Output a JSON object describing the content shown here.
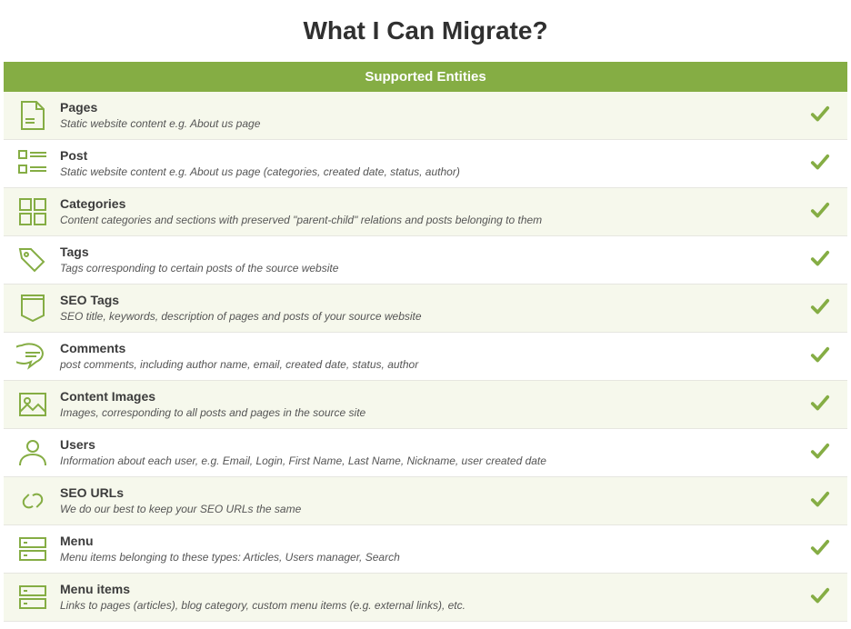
{
  "page_title": "What I Can Migrate?",
  "header_label": "Supported Entities",
  "entities": [
    {
      "title": "Pages",
      "desc": "Static website content e.g. About us page"
    },
    {
      "title": "Post",
      "desc": "Static website content e.g. About us page (categories, created date, status, author)"
    },
    {
      "title": "Categories",
      "desc": "Content categories and sections with preserved \"parent-child\" relations and posts belonging to them"
    },
    {
      "title": "Tags",
      "desc": "Tags corresponding to certain posts of the source website"
    },
    {
      "title": "SEO Tags",
      "desc": "SEO title, keywords, description of pages and posts of your source website"
    },
    {
      "title": "Comments",
      "desc": "post comments, including author name, email, created date, status, author"
    },
    {
      "title": "Content Images",
      "desc": "Images, corresponding to all posts and pages in the source site"
    },
    {
      "title": "Users",
      "desc": "Information about each user, e.g. Email, Login, First Name, Last Name, Nickname, user created date"
    },
    {
      "title": "SEO URLs",
      "desc": "We do our best to keep your SEO URLs the same"
    },
    {
      "title": "Menu",
      "desc": "Menu items belonging to these types: Articles, Users manager, Search"
    },
    {
      "title": "Menu items",
      "desc": "Links to pages (articles), blog category, custom menu items (e.g. external links), etc."
    }
  ]
}
